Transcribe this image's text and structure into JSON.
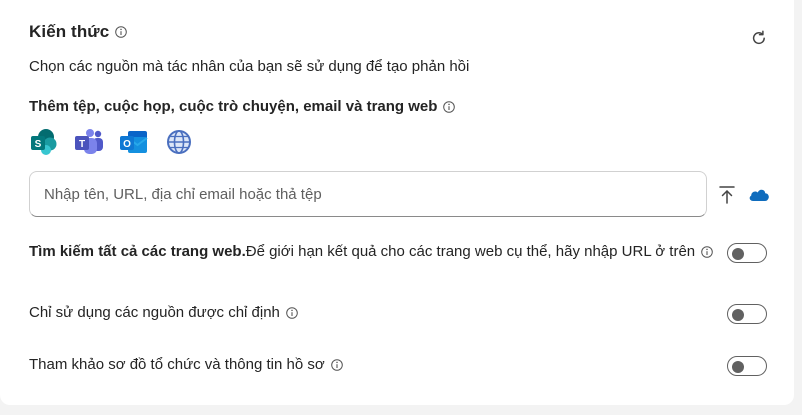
{
  "knowledge": {
    "title": "Kiến thức",
    "description": "Chọn các nguồn mà tác nhân của bạn sẽ sử dụng để tạo phản hồi",
    "add_heading": "Thêm tệp, cuộc họp, cuộc trò chuyện, email và trang web",
    "sources": [
      {
        "icon": "sharepoint-icon",
        "label": "S"
      },
      {
        "icon": "teams-icon",
        "label": "T"
      },
      {
        "icon": "outlook-icon",
        "label": "O"
      },
      {
        "icon": "web-icon"
      }
    ],
    "search": {
      "placeholder": "Nhập tên, URL, địa chỉ email hoặc thả tệp",
      "value": ""
    },
    "options": [
      {
        "bold": "Tìm kiếm tất cả các trang web.",
        "text": " Để giới hạn kết quả cho các trang web cụ thể, hãy nhập URL ở trên",
        "enabled": false
      },
      {
        "bold": "",
        "text": "Chỉ sử dụng các nguồn được chỉ định",
        "enabled": false
      },
      {
        "bold": "",
        "text": "Tham khảo sơ đồ tổ chức và thông tin hồ sơ",
        "enabled": false
      }
    ]
  },
  "colors": {
    "sharepoint": "#036c70",
    "teams": "#5b5fc7",
    "outlook": "#0a64c8",
    "web": "#4a6fbf",
    "onedrive": "#0f6cbd"
  }
}
